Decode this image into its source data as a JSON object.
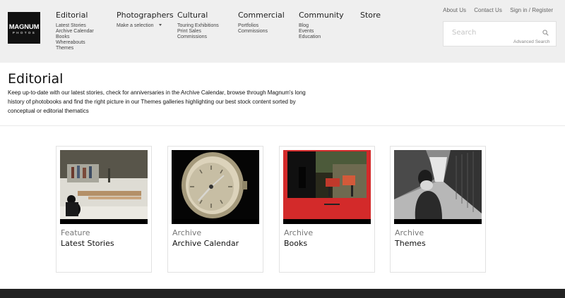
{
  "logo": {
    "line1": "MAGNUM",
    "line2": "PHOTOS"
  },
  "nav": [
    {
      "title": "Editorial",
      "items": [
        "Latest Stories",
        "Archive Calendar",
        "Books",
        "Whereabouts",
        "Themes"
      ]
    },
    {
      "title": "Photographers",
      "items": [
        "Make a selection"
      ]
    },
    {
      "title": "Cultural",
      "items": [
        "Touring Exhibitions",
        "Print Sales",
        "Commissions"
      ]
    },
    {
      "title": "Commercial",
      "items": [
        "Portfolios",
        "Commissions"
      ]
    },
    {
      "title": "Community",
      "items": [
        "Blog",
        "Events",
        "Education"
      ]
    },
    {
      "title": "Store",
      "items": []
    }
  ],
  "utility": {
    "about": "About Us",
    "contact": "Contact Us",
    "signin": "Sign in / Register"
  },
  "search": {
    "placeholder": "Search",
    "advanced": "Advanced Search"
  },
  "page": {
    "title": "Editorial",
    "intro": "Keep up-to-date with our latest stories, check for anniversaries in the Archive Calendar, browse through Magnum's long history of photobooks and find the right picture in our Themes galleries highlighting our best stock content sorted by conceptual or editorial thematics"
  },
  "cards": [
    {
      "label": "Feature",
      "title": "Latest Stories"
    },
    {
      "label": "Archive",
      "title": "Archive Calendar"
    },
    {
      "label": "Archive",
      "title": "Books"
    },
    {
      "label": "Archive",
      "title": "Themes"
    }
  ],
  "colors": {
    "header_bg": "#efefef",
    "logo_bg": "#111111",
    "footer_bg": "#222222",
    "book_red": "#d32a2a"
  }
}
